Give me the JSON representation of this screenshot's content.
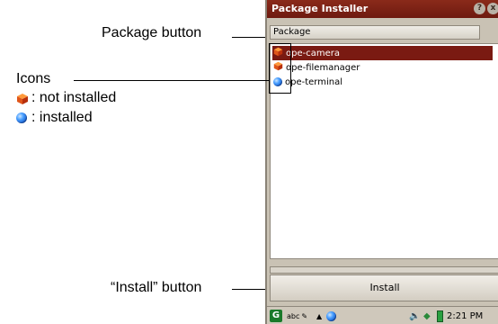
{
  "annotations": {
    "package_button_note": "Package button",
    "icons_heading": "Icons",
    "not_installed_label": ": not installed",
    "installed_label": ": installed",
    "install_button_note": "“Install” button"
  },
  "window": {
    "title": "Package Installer",
    "help_glyph": "?",
    "close_glyph": "x",
    "package_column_label": "Package",
    "install_button_label": "Install"
  },
  "packages": [
    {
      "name": "ope-camera",
      "status": "not installed",
      "selected": true
    },
    {
      "name": "ope-filemanager",
      "status": "not installed",
      "selected": false
    },
    {
      "name": "ope-terminal",
      "status": "installed",
      "selected": false
    }
  ],
  "taskbar": {
    "input_mode": "abc",
    "clock": "2:21 PM"
  },
  "colors": {
    "titlebar": "#7a1a12",
    "selection": "#7a1a12",
    "window_bg": "#c9c2b4"
  }
}
